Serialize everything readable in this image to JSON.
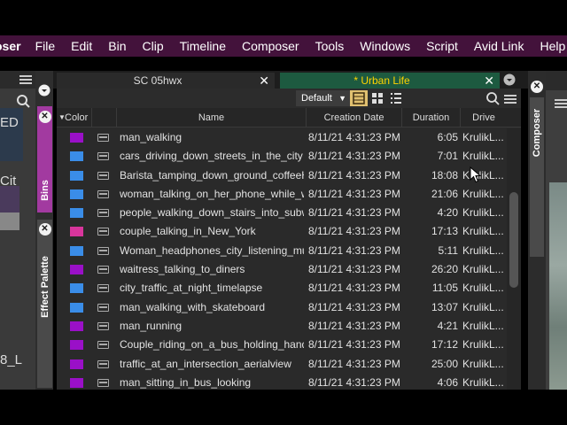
{
  "menubar": {
    "app": "oser",
    "items": [
      "File",
      "Edit",
      "Bin",
      "Clip",
      "Timeline",
      "Composer",
      "Tools",
      "Windows",
      "Script",
      "Avid Link",
      "Help"
    ]
  },
  "left_panel": {
    "text1": "ED",
    "text2": "Cit",
    "text3": "8_L"
  },
  "vtabs": {
    "bins": "Bins",
    "effect": "Effect Palette",
    "composer": "Composer"
  },
  "tabs": {
    "tab1": "SC 05hwx",
    "tab2": "* Urban Life"
  },
  "toolbar": {
    "view": "Default"
  },
  "columns": {
    "color": "Color",
    "name": "Name",
    "created": "Creation Date",
    "duration": "Duration",
    "drive": "Drive"
  },
  "colors": {
    "purple": "#9a10c8",
    "blue": "#3a8de8",
    "pink": "#d8359c",
    "accent": "#1d5a40",
    "menubar": "#43123b"
  },
  "rows": [
    {
      "color": "purple",
      "name": "man_walking",
      "created": "8/11/21 4:31:23 PM",
      "duration": "6:05",
      "drive": "KrulikL..."
    },
    {
      "color": "blue",
      "name": "cars_driving_down_streets_in_the_city",
      "created": "8/11/21 4:31:23 PM",
      "duration": "7:01",
      "drive": "KrulikL..."
    },
    {
      "color": "blue",
      "name": "Barista_tamping_down_ground_coffeeH...",
      "created": "8/11/21 4:31:23 PM",
      "duration": "18:08",
      "drive": "KrulikL..."
    },
    {
      "color": "blue",
      "name": "woman_talking_on_her_phone_while_w...",
      "created": "8/11/21 4:31:23 PM",
      "duration": "21:06",
      "drive": "KrulikL..."
    },
    {
      "color": "blue",
      "name": "people_walking_down_stairs_into_subw...",
      "created": "8/11/21 4:31:23 PM",
      "duration": "4:20",
      "drive": "KrulikL..."
    },
    {
      "color": "pink",
      "name": "couple_talking_in_New_York",
      "created": "8/11/21 4:31:23 PM",
      "duration": "17:13",
      "drive": "KrulikL..."
    },
    {
      "color": "blue",
      "name": "Woman_headphones_city_listening_mu...",
      "created": "8/11/21 4:31:23 PM",
      "duration": "5:11",
      "drive": "KrulikL..."
    },
    {
      "color": "purple",
      "name": "waitress_talking_to_diners",
      "created": "8/11/21 4:31:23 PM",
      "duration": "26:20",
      "drive": "KrulikL..."
    },
    {
      "color": "blue",
      "name": "city_traffic_at_night_timelapse",
      "created": "8/11/21 4:31:23 PM",
      "duration": "11:05",
      "drive": "KrulikL..."
    },
    {
      "color": "blue",
      "name": "man_walking_with_skateboard",
      "created": "8/11/21 4:31:23 PM",
      "duration": "13:07",
      "drive": "KrulikL..."
    },
    {
      "color": "purple",
      "name": "man_running",
      "created": "8/11/21 4:31:23 PM",
      "duration": "4:21",
      "drive": "KrulikL..."
    },
    {
      "color": "purple",
      "name": "Couple_riding_on_a_bus_holding_hands",
      "created": "8/11/21 4:31:23 PM",
      "duration": "17:12",
      "drive": "KrulikL..."
    },
    {
      "color": "purple",
      "name": "traffic_at_an_intersection_aerialview",
      "created": "8/11/21 4:31:23 PM",
      "duration": "25:00",
      "drive": "KrulikL..."
    },
    {
      "color": "purple",
      "name": "man_sitting_in_bus_looking",
      "created": "8/11/21 4:31:23 PM",
      "duration": "4:06",
      "drive": "KrulikL..."
    }
  ]
}
